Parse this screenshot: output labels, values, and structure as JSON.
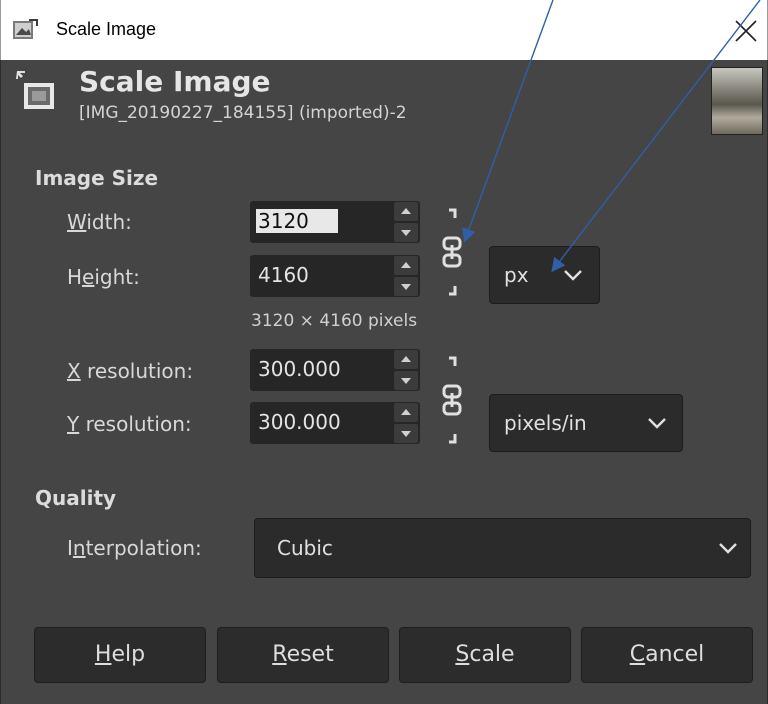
{
  "window": {
    "title": "Scale Image"
  },
  "header": {
    "title": "Scale Image",
    "subtitle": "[IMG_20190227_184155] (imported)-2"
  },
  "image_size": {
    "section_label": "Image Size",
    "width_label_pre": "",
    "width_label_u": "W",
    "width_label_post": "idth:",
    "width_value": "3120",
    "height_label_pre": "H",
    "height_label_u": "e",
    "height_label_post": "ight:",
    "height_value": "4160",
    "pixels_info": "3120 × 4160 pixels",
    "unit": "px",
    "x_res_label_u": "X",
    "x_res_label_post": " resolution:",
    "x_res_value": "300.000",
    "y_res_label_u": "Y",
    "y_res_label_post": " resolution:",
    "y_res_value": "300.000",
    "res_unit": "pixels/in"
  },
  "quality": {
    "section_label": "Quality",
    "interp_label_pre": "I",
    "interp_label_u": "n",
    "interp_label_post": "terpolation:",
    "interp_value": "Cubic"
  },
  "buttons": {
    "help_u": "H",
    "help_post": "elp",
    "reset_u": "R",
    "reset_post": "eset",
    "scale_u": "S",
    "scale_post": "cale",
    "cancel_u": "C",
    "cancel_post": "ancel"
  },
  "icons": [
    "gimp-app-icon",
    "close-icon",
    "scale-image-icon",
    "image-thumbnail",
    "chain-link-icon",
    "chevron-down-icon",
    "annotation-arrow"
  ],
  "colors": {
    "dialog_bg": "#454545",
    "field_bg": "#262626",
    "text": "#dcdcdc",
    "arrow": "#2f5fa6"
  }
}
